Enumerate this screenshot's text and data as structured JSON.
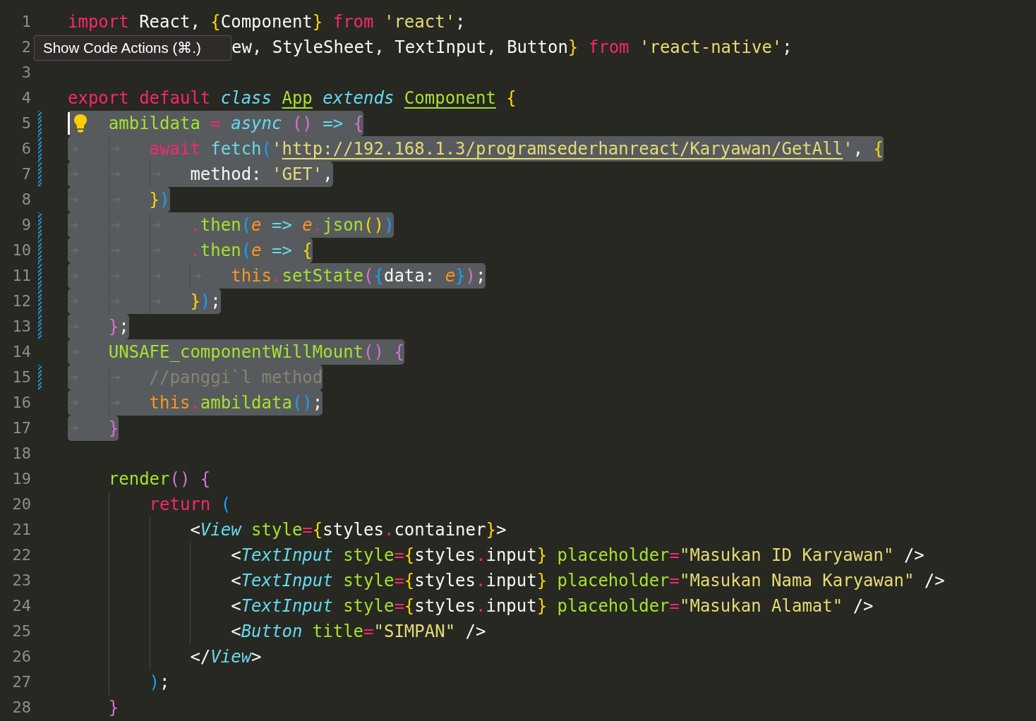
{
  "editor": {
    "lines": [
      {
        "number": "1",
        "selected": false,
        "modified": false,
        "tokens": [
          {
            "kind": "keyword",
            "text": "import"
          },
          {
            "kind": "plain",
            "text": " React, "
          },
          {
            "kind": "yellowbracket",
            "text": "{"
          },
          {
            "kind": "plain",
            "text": "Component"
          },
          {
            "kind": "yellowbracket",
            "text": "} "
          },
          {
            "kind": "keyword",
            "text": "from "
          },
          {
            "kind": "string",
            "text": "'react'"
          },
          {
            "kind": "plain",
            "text": ";"
          }
        ]
      },
      {
        "number": "2",
        "selected": false,
        "modified": false,
        "tooltip": "Show Code Actions (⌘.)",
        "tokens": [
          {
            "kind": "plain",
            "text": "ew, StyleSheet, TextInput, Button"
          },
          {
            "kind": "yellowbracket",
            "text": "} "
          },
          {
            "kind": "keyword",
            "text": "from "
          },
          {
            "kind": "string",
            "text": "'react-native'"
          },
          {
            "kind": "plain",
            "text": ";"
          }
        ]
      },
      {
        "number": "3",
        "selected": false,
        "modified": false
      },
      {
        "number": "4",
        "selected": false,
        "modified": false,
        "tokens": [
          {
            "kind": "keyword",
            "text": "export default "
          },
          {
            "kind": "storage",
            "text": "class "
          },
          {
            "kind": "classname",
            "text": "App"
          },
          {
            "kind": "storage",
            "text": " extends "
          },
          {
            "kind": "classname",
            "text": "Component"
          },
          {
            "kind": "yellowbracket",
            "text": " {"
          }
        ],
        "children": [
          {
            "number": "5",
            "selected": true,
            "modified": true,
            "lightbulb": true,
            "cursor": true,
            "tokens": [
              {
                "kind": "function",
                "text": "ambildata "
              },
              {
                "kind": "keyword",
                "text": "= "
              },
              {
                "kind": "storage",
                "text": "async "
              },
              {
                "kind": "pinkbracket",
                "text": "() "
              },
              {
                "kind": "operator",
                "text": "=> "
              },
              {
                "kind": "pinkbracket",
                "text": "{"
              }
            ],
            "children": [
              {
                "number": "6",
                "selected": true,
                "modified": true,
                "tokens": [
                  {
                    "kind": "keyword",
                    "text": "await "
                  },
                  {
                    "kind": "support",
                    "text": "fetch"
                  },
                  {
                    "kind": "bluebracket",
                    "text": "("
                  },
                  {
                    "kind": "string",
                    "text": "'"
                  },
                  {
                    "kind": "link",
                    "text": "http://192.168.1.3/programsederhanreact/Karyawan/GetAll"
                  },
                  {
                    "kind": "string",
                    "text": "'"
                  },
                  {
                    "kind": "plain",
                    "text": ", "
                  },
                  {
                    "kind": "yellowbracket",
                    "text": "{"
                  }
                ],
                "children": [
                  {
                    "number": "7",
                    "selected": true,
                    "modified": true,
                    "tokens": [
                      {
                        "kind": "plain",
                        "text": "method: "
                      },
                      {
                        "kind": "string",
                        "text": "'GET'"
                      },
                      {
                        "kind": "plain",
                        "text": ","
                      }
                    ]
                  }
                ]
              },
              {
                "number": "8",
                "selected": true,
                "modified": false,
                "tokens": [
                  {
                    "kind": "yellowbracket",
                    "text": "}"
                  },
                  {
                    "kind": "bluebracket",
                    "text": ")"
                  }
                ],
                "children": [
                  {
                    "number": "9",
                    "selected": true,
                    "modified": true,
                    "tokens": [
                      {
                        "kind": "keyword",
                        "text": "."
                      },
                      {
                        "kind": "function",
                        "text": "then"
                      },
                      {
                        "kind": "bluebracket",
                        "text": "("
                      },
                      {
                        "kind": "param",
                        "text": "e "
                      },
                      {
                        "kind": "operator",
                        "text": "=> "
                      },
                      {
                        "kind": "param",
                        "text": "e"
                      },
                      {
                        "kind": "keyword",
                        "text": "."
                      },
                      {
                        "kind": "function",
                        "text": "json"
                      },
                      {
                        "kind": "yellowbracket",
                        "text": "()"
                      },
                      {
                        "kind": "bluebracket",
                        "text": ")"
                      }
                    ]
                  },
                  {
                    "number": "10",
                    "selected": true,
                    "modified": true,
                    "tokens": [
                      {
                        "kind": "keyword",
                        "text": "."
                      },
                      {
                        "kind": "function",
                        "text": "then"
                      },
                      {
                        "kind": "bluebracket",
                        "text": "("
                      },
                      {
                        "kind": "param",
                        "text": "e "
                      },
                      {
                        "kind": "operator",
                        "text": "=> "
                      },
                      {
                        "kind": "yellowbracket",
                        "text": "{"
                      }
                    ],
                    "children": [
                      {
                        "number": "11",
                        "selected": true,
                        "modified": true,
                        "tokens": [
                          {
                            "kind": "this",
                            "text": "this"
                          },
                          {
                            "kind": "keyword",
                            "text": "."
                          },
                          {
                            "kind": "function",
                            "text": "setState"
                          },
                          {
                            "kind": "pinkbracket",
                            "text": "("
                          },
                          {
                            "kind": "bluebracket",
                            "text": "{"
                          },
                          {
                            "kind": "plain",
                            "text": "data: "
                          },
                          {
                            "kind": "param",
                            "text": "e"
                          },
                          {
                            "kind": "bluebracket",
                            "text": "}"
                          },
                          {
                            "kind": "pinkbracket",
                            "text": ")"
                          },
                          {
                            "kind": "plain",
                            "text": ";"
                          }
                        ]
                      }
                    ]
                  },
                  {
                    "number": "12",
                    "selected": true,
                    "modified": true,
                    "tokens": [
                      {
                        "kind": "yellowbracket",
                        "text": "}"
                      },
                      {
                        "kind": "bluebracket",
                        "text": ")"
                      },
                      {
                        "kind": "plain",
                        "text": ";"
                      }
                    ]
                  }
                ]
              }
            ]
          },
          {
            "number": "13",
            "selected": true,
            "modified": true,
            "tokens": [
              {
                "kind": "pinkbracket",
                "text": "}"
              },
              {
                "kind": "plain",
                "text": ";"
              }
            ]
          },
          {
            "number": "14",
            "selected": true,
            "modified": false,
            "tokens": [
              {
                "kind": "function",
                "text": "UNSAFE_componentWillMount"
              },
              {
                "kind": "pinkbracket",
                "text": "() {"
              }
            ],
            "children": [
              {
                "number": "15",
                "selected": true,
                "modified": true,
                "tokens": [
                  {
                    "kind": "comment",
                    "text": "//panggi`l method"
                  }
                ]
              },
              {
                "number": "16",
                "selected": true,
                "modified": false,
                "tokens": [
                  {
                    "kind": "this",
                    "text": "this"
                  },
                  {
                    "kind": "keyword",
                    "text": "."
                  },
                  {
                    "kind": "function",
                    "text": "ambildata"
                  },
                  {
                    "kind": "bluebracket",
                    "text": "()"
                  },
                  {
                    "kind": "plain",
                    "text": ";"
                  }
                ]
              }
            ]
          },
          {
            "number": "17",
            "selected": true,
            "modified": false,
            "tokens": [
              {
                "kind": "pinkbracket",
                "text": "}"
              }
            ]
          }
        ]
      },
      {
        "number": "18",
        "selected": false,
        "modified": false,
        "children": [
          {
            "number": "19",
            "selected": false,
            "modified": false,
            "tokens": [
              {
                "kind": "function",
                "text": "render"
              },
              {
                "kind": "pinkbracket",
                "text": "() {"
              }
            ],
            "children": [
              {
                "number": "20",
                "selected": false,
                "modified": false,
                "tokens": [
                  {
                    "kind": "keyword",
                    "text": "return "
                  },
                  {
                    "kind": "bluebracket",
                    "text": "("
                  }
                ],
                "children": [
                  {
                    "number": "21",
                    "selected": false,
                    "modified": false,
                    "tokens": [
                      {
                        "kind": "plain",
                        "text": "<"
                      },
                      {
                        "kind": "storage",
                        "text": "View "
                      },
                      {
                        "kind": "function",
                        "text": "style"
                      },
                      {
                        "kind": "keyword",
                        "text": "="
                      },
                      {
                        "kind": "yellowbracket",
                        "text": "{"
                      },
                      {
                        "kind": "plain",
                        "text": "styles"
                      },
                      {
                        "kind": "keyword",
                        "text": "."
                      },
                      {
                        "kind": "plain",
                        "text": "container"
                      },
                      {
                        "kind": "yellowbracket",
                        "text": "}"
                      },
                      {
                        "kind": "plain",
                        "text": ">"
                      }
                    ],
                    "children": [
                      {
                        "number": "22",
                        "selected": false,
                        "modified": false,
                        "tokens": [
                          {
                            "kind": "plain",
                            "text": "<"
                          },
                          {
                            "kind": "storage",
                            "text": "TextInput "
                          },
                          {
                            "kind": "function",
                            "text": "style"
                          },
                          {
                            "kind": "keyword",
                            "text": "="
                          },
                          {
                            "kind": "yellowbracket",
                            "text": "{"
                          },
                          {
                            "kind": "plain",
                            "text": "styles"
                          },
                          {
                            "kind": "keyword",
                            "text": "."
                          },
                          {
                            "kind": "plain",
                            "text": "input"
                          },
                          {
                            "kind": "yellowbracket",
                            "text": "} "
                          },
                          {
                            "kind": "function",
                            "text": "placeholder"
                          },
                          {
                            "kind": "keyword",
                            "text": "="
                          },
                          {
                            "kind": "string",
                            "text": "\"Masukan ID Karyawan\""
                          },
                          {
                            "kind": "plain",
                            "text": " />"
                          }
                        ]
                      },
                      {
                        "number": "23",
                        "selected": false,
                        "modified": false,
                        "tokens": [
                          {
                            "kind": "plain",
                            "text": "<"
                          },
                          {
                            "kind": "storage",
                            "text": "TextInput "
                          },
                          {
                            "kind": "function",
                            "text": "style"
                          },
                          {
                            "kind": "keyword",
                            "text": "="
                          },
                          {
                            "kind": "yellowbracket",
                            "text": "{"
                          },
                          {
                            "kind": "plain",
                            "text": "styles"
                          },
                          {
                            "kind": "keyword",
                            "text": "."
                          },
                          {
                            "kind": "plain",
                            "text": "input"
                          },
                          {
                            "kind": "yellowbracket",
                            "text": "} "
                          },
                          {
                            "kind": "function",
                            "text": "placeholder"
                          },
                          {
                            "kind": "keyword",
                            "text": "="
                          },
                          {
                            "kind": "string",
                            "text": "\"Masukan Nama Karyawan\""
                          },
                          {
                            "kind": "plain",
                            "text": " />"
                          }
                        ]
                      },
                      {
                        "number": "24",
                        "selected": false,
                        "modified": false,
                        "tokens": [
                          {
                            "kind": "plain",
                            "text": "<"
                          },
                          {
                            "kind": "storage",
                            "text": "TextInput "
                          },
                          {
                            "kind": "function",
                            "text": "style"
                          },
                          {
                            "kind": "keyword",
                            "text": "="
                          },
                          {
                            "kind": "yellowbracket",
                            "text": "{"
                          },
                          {
                            "kind": "plain",
                            "text": "styles"
                          },
                          {
                            "kind": "keyword",
                            "text": "."
                          },
                          {
                            "kind": "plain",
                            "text": "input"
                          },
                          {
                            "kind": "yellowbracket",
                            "text": "} "
                          },
                          {
                            "kind": "function",
                            "text": "placeholder"
                          },
                          {
                            "kind": "keyword",
                            "text": "="
                          },
                          {
                            "kind": "string",
                            "text": "\"Masukan Alamat\""
                          },
                          {
                            "kind": "plain",
                            "text": " />"
                          }
                        ]
                      },
                      {
                        "number": "25",
                        "selected": false,
                        "modified": false,
                        "tokens": [
                          {
                            "kind": "plain",
                            "text": "<"
                          },
                          {
                            "kind": "storage",
                            "text": "Button "
                          },
                          {
                            "kind": "function",
                            "text": "title"
                          },
                          {
                            "kind": "keyword",
                            "text": "="
                          },
                          {
                            "kind": "string",
                            "text": "\"SIMPAN\""
                          },
                          {
                            "kind": "plain",
                            "text": " />"
                          }
                        ]
                      }
                    ]
                  },
                  {
                    "number": "26",
                    "selected": false,
                    "modified": false,
                    "tokens": [
                      {
                        "kind": "plain",
                        "text": "</"
                      },
                      {
                        "kind": "storage",
                        "text": "View"
                      },
                      {
                        "kind": "plain",
                        "text": ">"
                      }
                    ]
                  }
                ]
              },
              {
                "number": "27",
                "selected": false,
                "modified": false,
                "tokens": [
                  {
                    "kind": "bluebracket",
                    "text": ")"
                  },
                  {
                    "kind": "plain",
                    "text": ";"
                  }
                ]
              }
            ]
          },
          {
            "number": "28",
            "selected": false,
            "modified": false,
            "tokens": [
              {
                "kind": "pinkbracket",
                "text": "}"
              }
            ]
          }
        ]
      }
    ]
  }
}
